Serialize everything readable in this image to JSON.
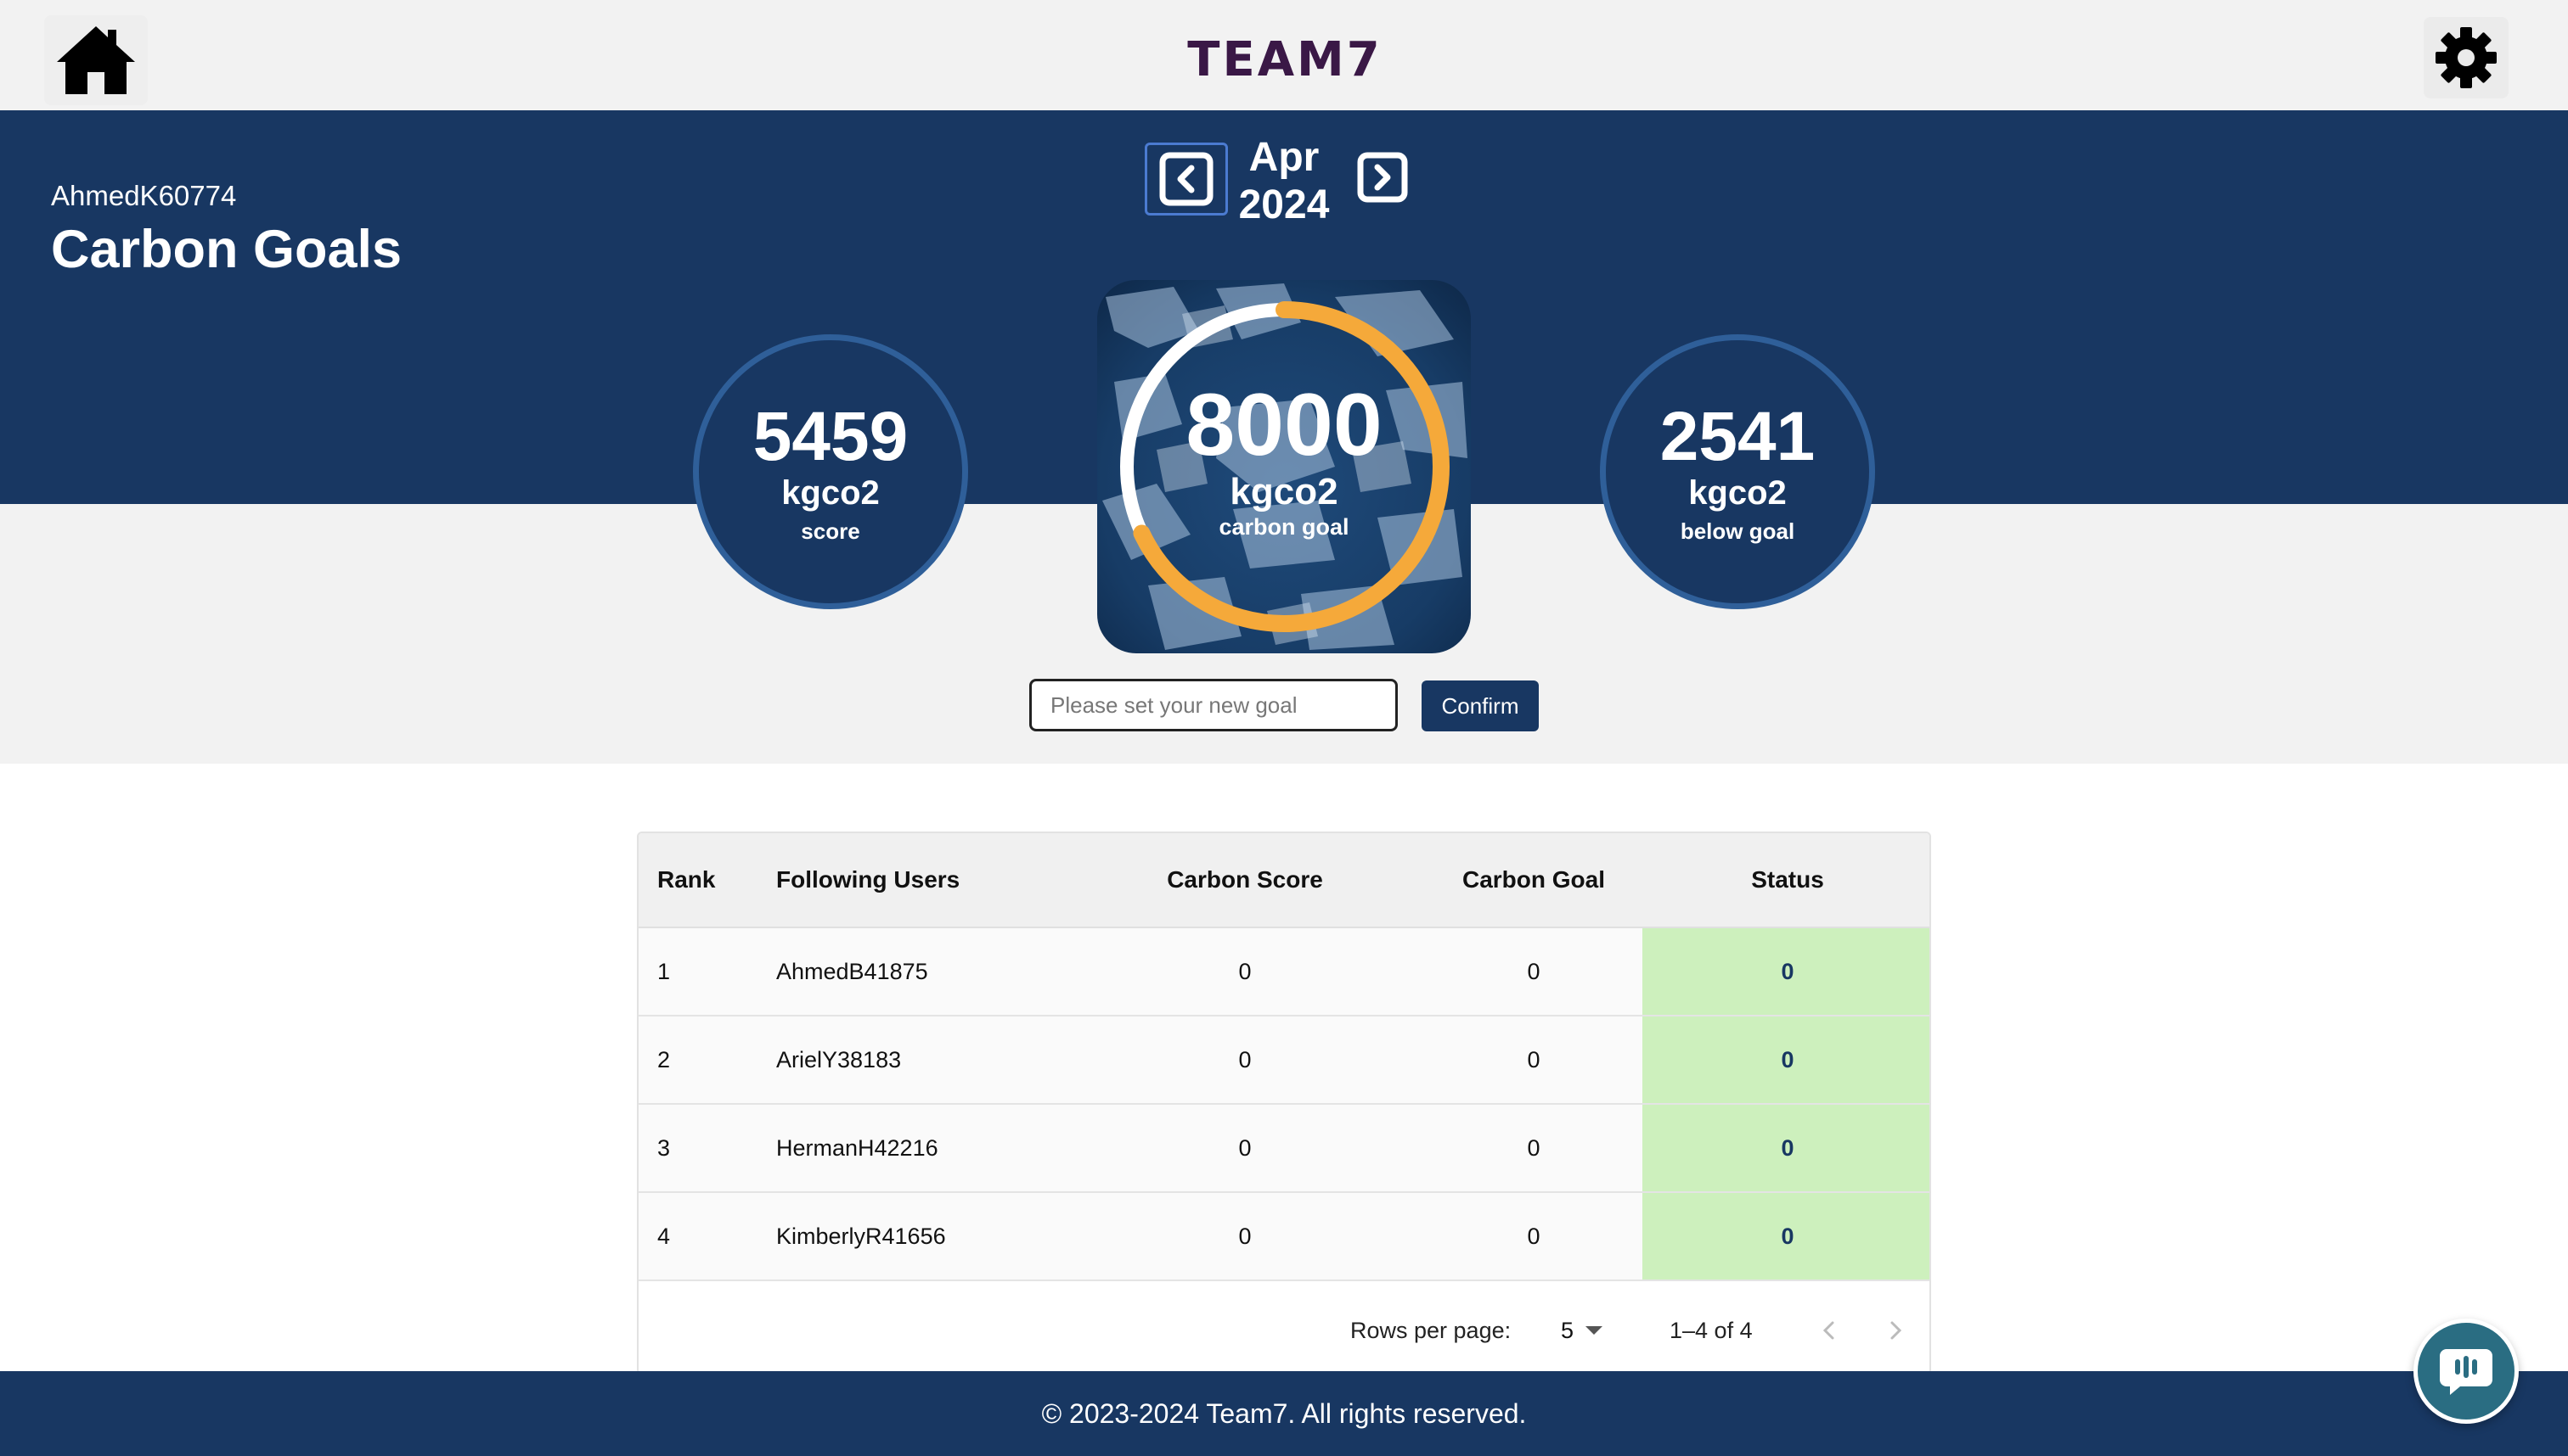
{
  "app": {
    "logo_text": "TEAM7",
    "home_icon": "home-icon",
    "settings_icon": "gear-icon"
  },
  "header": {
    "username": "AhmedK60774",
    "title": "Carbon Goals"
  },
  "month_selector": {
    "month": "Apr",
    "year": "2024",
    "prev_icon": "chevron-left-icon",
    "next_icon": "chevron-right-icon"
  },
  "stats": {
    "score": {
      "value": "5459",
      "unit": "kgco2",
      "label": "score"
    },
    "goal": {
      "value": "8000",
      "unit": "kgco2",
      "label": "carbon goal",
      "progress": 0.68
    },
    "below": {
      "value": "2541",
      "unit": "kgco2",
      "label": "below goal"
    }
  },
  "goal_form": {
    "placeholder": "Please set your new goal",
    "value": "",
    "confirm_label": "Confirm"
  },
  "table": {
    "columns": [
      "Rank",
      "Following Users",
      "Carbon Score",
      "Carbon Goal",
      "Status"
    ],
    "rows": [
      {
        "rank": "1",
        "user": "AhmedB41875",
        "score": "0",
        "goal": "0",
        "status": "0"
      },
      {
        "rank": "2",
        "user": "ArielY38183",
        "score": "0",
        "goal": "0",
        "status": "0"
      },
      {
        "rank": "3",
        "user": "HermanH42216",
        "score": "0",
        "goal": "0",
        "status": "0"
      },
      {
        "rank": "4",
        "user": "KimberlyR41656",
        "score": "0",
        "goal": "0",
        "status": "0"
      }
    ],
    "pagination": {
      "rows_per_page_label": "Rows per page:",
      "rows_per_page": "5",
      "range": "1–4 of 4"
    }
  },
  "footer": {
    "text": "© 2023-2024 Team7. All rights reserved."
  },
  "colors": {
    "primary": "#183762",
    "accent": "#f5a93a",
    "status_bg": "#cdf0bd",
    "chat": "#2a6d82"
  }
}
